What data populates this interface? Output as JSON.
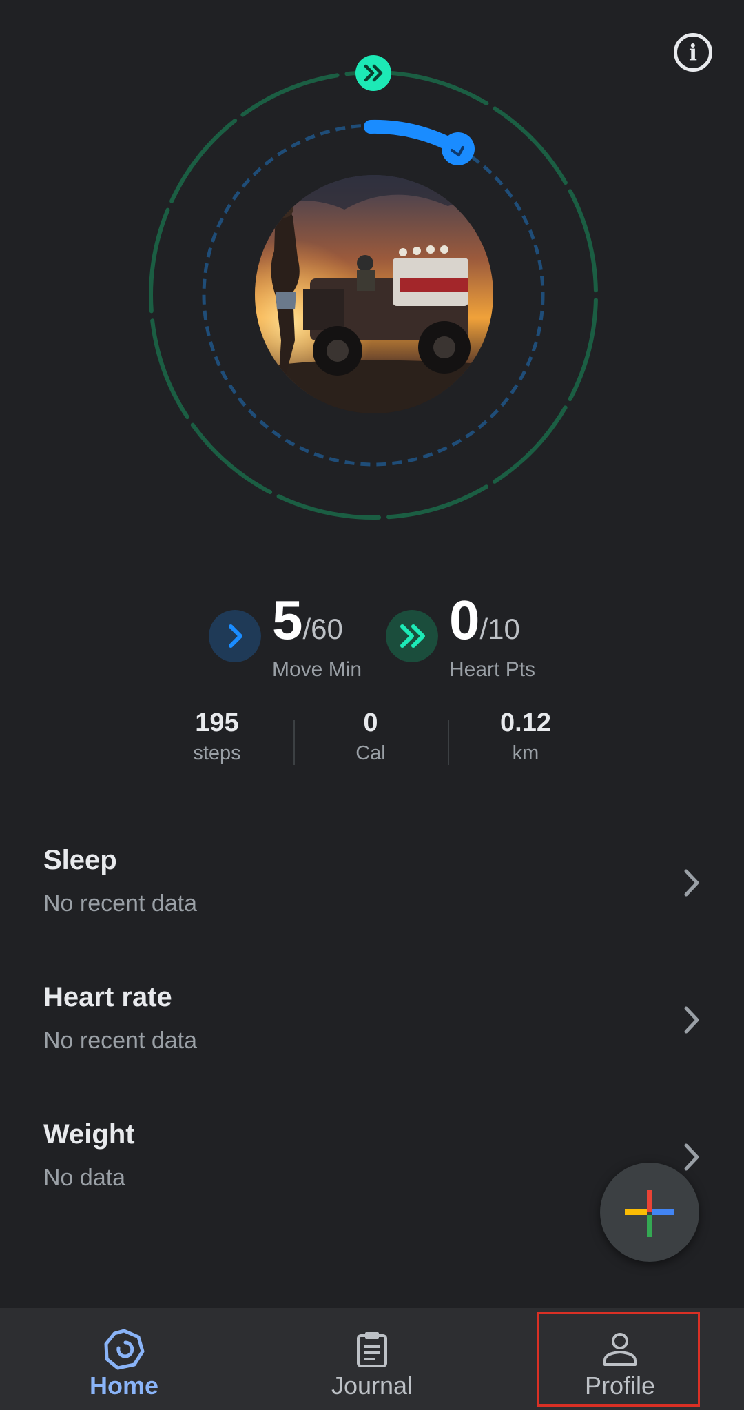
{
  "header": {
    "info_icon": "info-icon"
  },
  "rings": {
    "heart_pts_icon": "double-chevron-icon",
    "move_min_icon": "chevron-icon",
    "colors": {
      "heart_ring": "#1b5e43",
      "move_ring": "#1f4d78",
      "heart_accent": "#1de9b6",
      "move_accent": "#1a8cff"
    },
    "avatar_icon": "profile-photo"
  },
  "goals": {
    "move_min": {
      "value": "5",
      "total": "/60",
      "label": "Move Min"
    },
    "heart_pts": {
      "value": "0",
      "total": "/10",
      "label": "Heart Pts"
    }
  },
  "stats": [
    {
      "value": "195",
      "unit": "steps"
    },
    {
      "value": "0",
      "unit": "Cal"
    },
    {
      "value": "0.12",
      "unit": "km"
    }
  ],
  "cards": [
    {
      "title": "Sleep",
      "subtitle": "No recent data"
    },
    {
      "title": "Heart rate",
      "subtitle": "No recent data"
    },
    {
      "title": "Weight",
      "subtitle": "No data"
    }
  ],
  "fab": {
    "icon": "add-icon",
    "colors": [
      "#ea4335",
      "#4285f4",
      "#34a853",
      "#fbbc05"
    ]
  },
  "nav": {
    "items": [
      {
        "label": "Home",
        "icon": "home-icon",
        "active": true
      },
      {
        "label": "Journal",
        "icon": "journal-icon",
        "active": false
      },
      {
        "label": "Profile",
        "icon": "profile-icon",
        "active": false
      }
    ]
  }
}
